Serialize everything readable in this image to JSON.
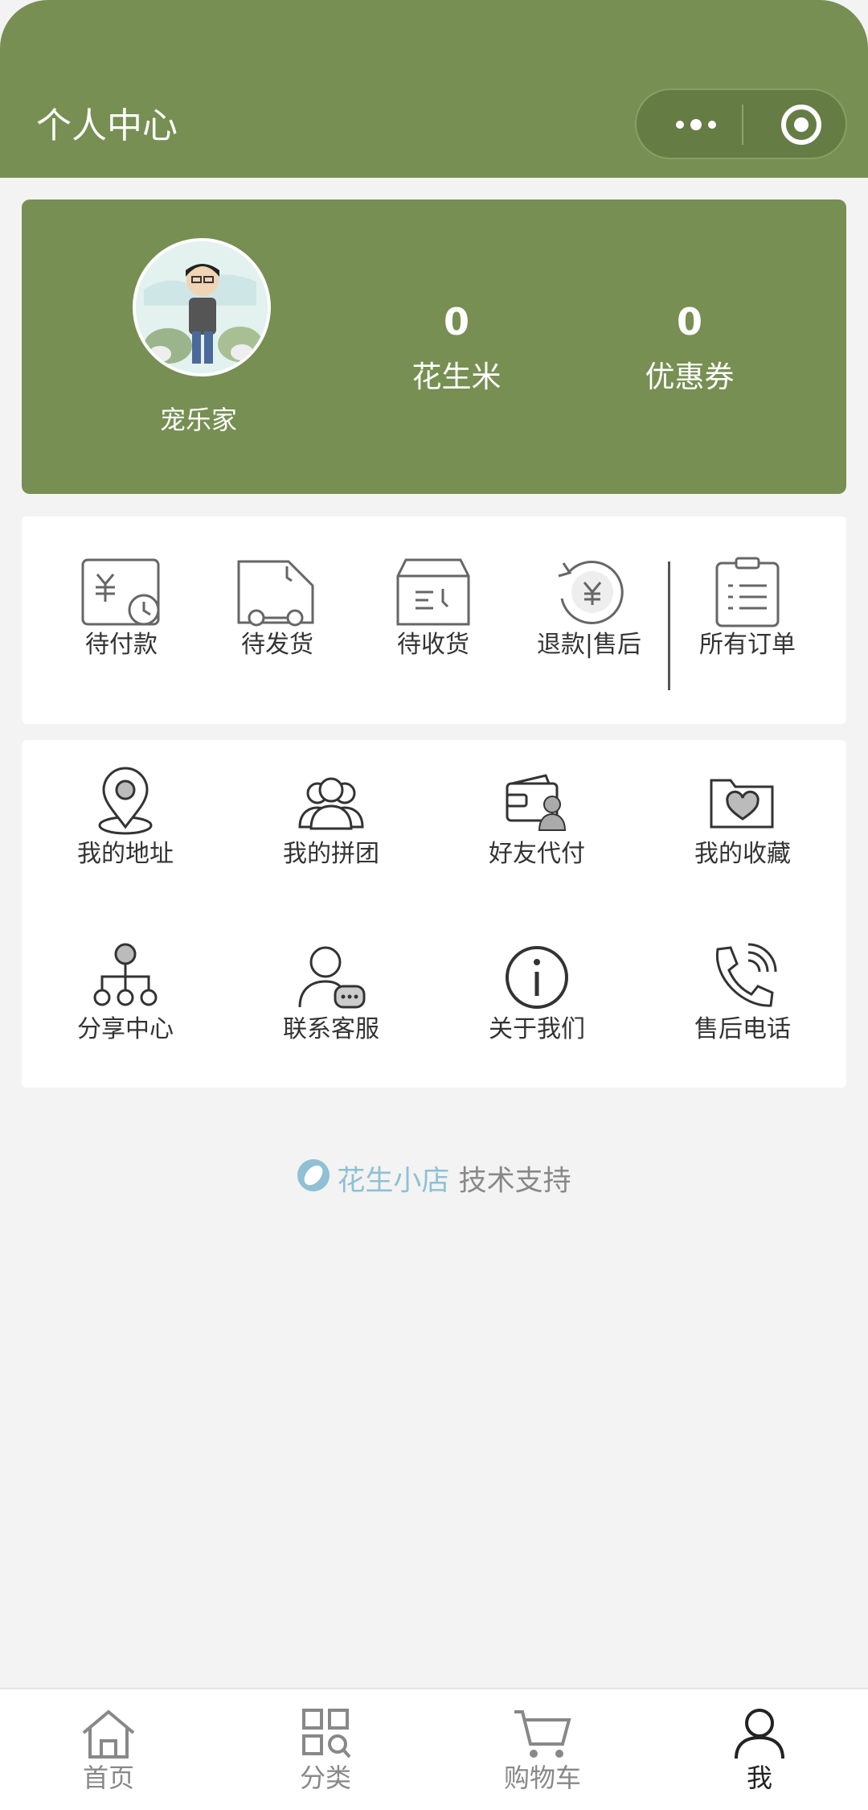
{
  "header": {
    "title": "个人中心",
    "bg_color": "#778f52"
  },
  "profile": {
    "username": "宠乐家",
    "stats": [
      {
        "value": "0",
        "label": "花生米"
      },
      {
        "value": "0",
        "label": "优惠券"
      }
    ]
  },
  "orders": [
    {
      "label": "待付款",
      "icon": "pending-payment-icon"
    },
    {
      "label": "待发货",
      "icon": "pending-shipment-icon"
    },
    {
      "label": "待收货",
      "icon": "pending-receipt-icon"
    },
    {
      "label": "退款|售后",
      "icon": "refund-icon"
    },
    {
      "label": "所有订单",
      "icon": "clipboard-icon"
    }
  ],
  "menu": [
    {
      "label": "我的地址",
      "icon": "location-icon"
    },
    {
      "label": "我的拼团",
      "icon": "group-icon"
    },
    {
      "label": "好友代付",
      "icon": "wallet-user-icon"
    },
    {
      "label": "我的收藏",
      "icon": "folder-heart-icon"
    },
    {
      "label": "分享中心",
      "icon": "share-tree-icon"
    },
    {
      "label": "联系客服",
      "icon": "customer-service-icon"
    },
    {
      "label": "关于我们",
      "icon": "info-icon"
    },
    {
      "label": "售后电话",
      "icon": "phone-icon"
    }
  ],
  "support": {
    "brand": "花生小店",
    "text": " 技术支持"
  },
  "tabbar": [
    {
      "label": "首页",
      "icon": "home-icon"
    },
    {
      "label": "分类",
      "icon": "category-icon"
    },
    {
      "label": "购物车",
      "icon": "cart-icon"
    },
    {
      "label": "我",
      "icon": "user-icon",
      "active": true
    }
  ]
}
